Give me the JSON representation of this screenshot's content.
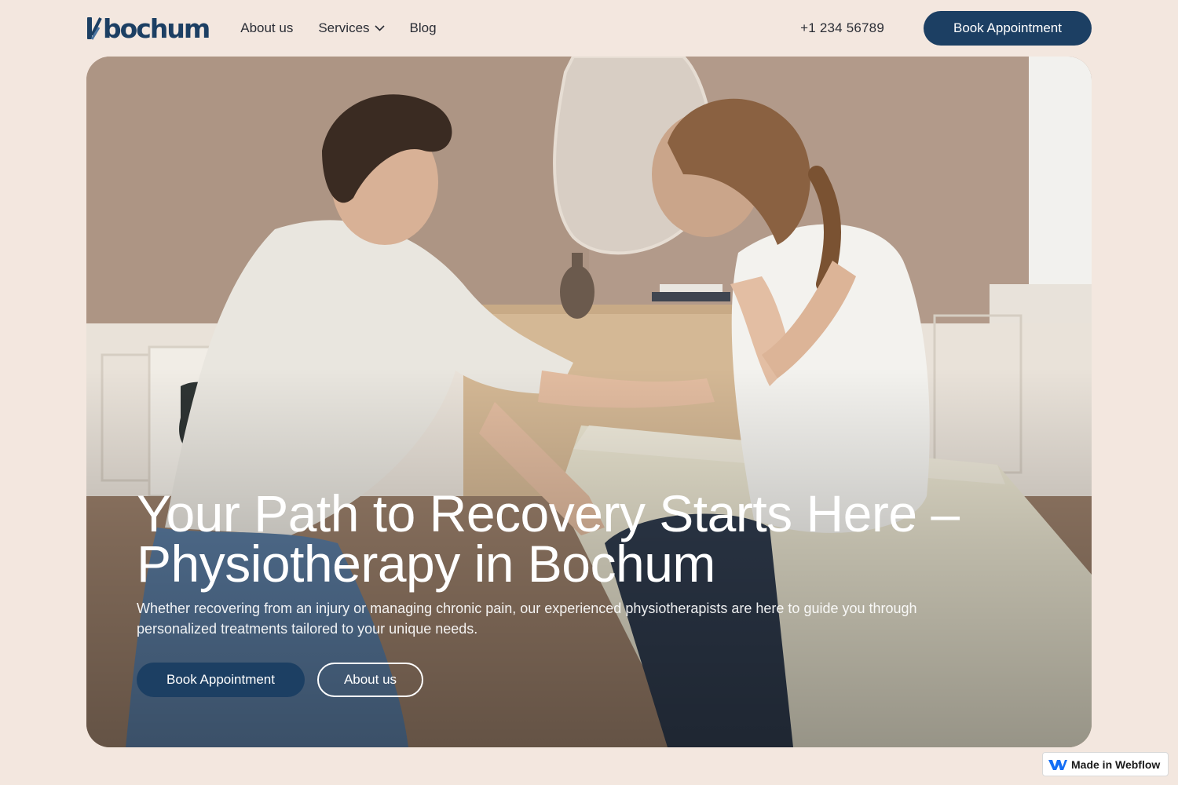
{
  "header": {
    "logo_text": "bochum",
    "nav": [
      {
        "label": "About us"
      },
      {
        "label": "Services"
      },
      {
        "label": "Blog"
      }
    ],
    "phone": "+1 234 56789",
    "book_label": "Book Appointment"
  },
  "hero": {
    "title": "Your Path to Recovery Starts Here – Physiotherapy in Bochum",
    "subtitle": "Whether recovering from an injury or managing chronic pain, our experienced physiotherapists are here to guide you through personalized treatments tailored to your unique needs.",
    "book_label": "Book Appointment",
    "about_label": "About us",
    "image_icon": "physiotherapy-session-photo"
  },
  "badge": {
    "label": "Made in Webflow",
    "icon": "webflow-logo-icon"
  },
  "colors": {
    "brand": "#1c3f63",
    "page_background": "#f3e7df",
    "text": "#2a2d35"
  }
}
